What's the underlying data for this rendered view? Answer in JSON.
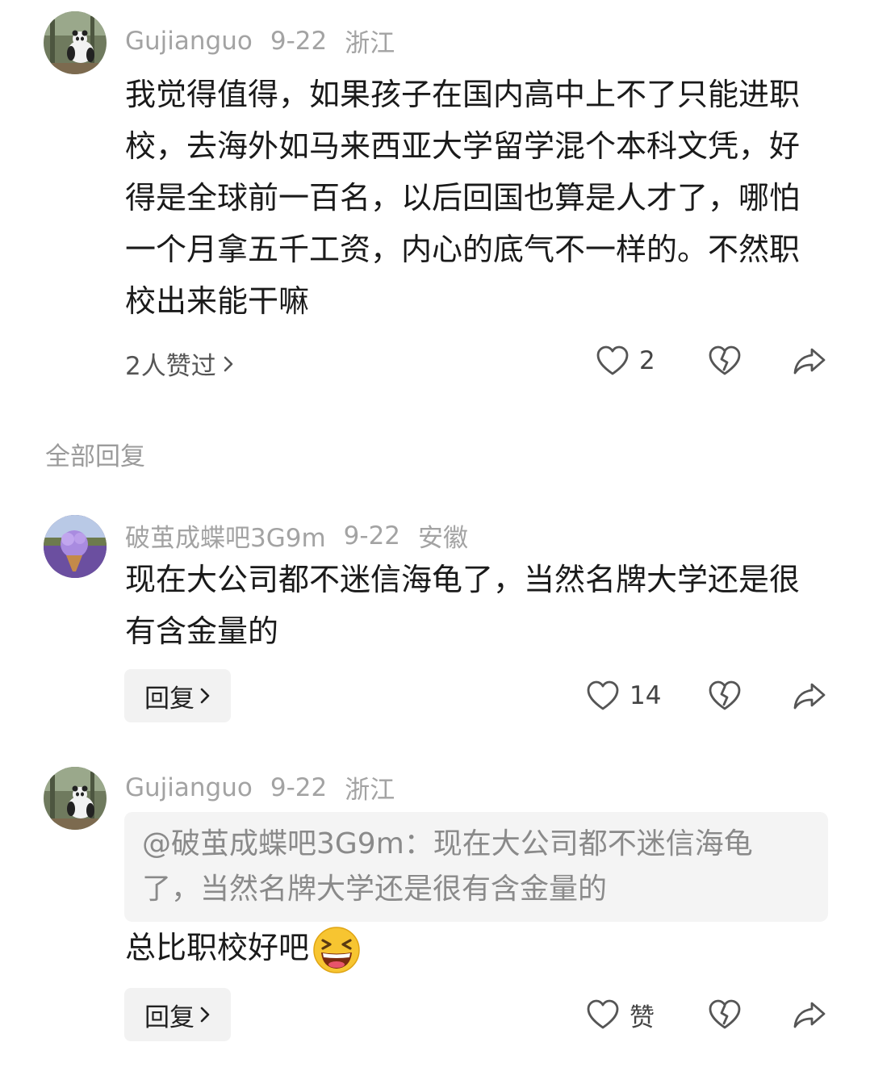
{
  "post": {
    "author": "Gujianguo",
    "date": "9-22",
    "location": "浙江",
    "text": "我觉得值得，如果孩子在国内高中上不了只能进职校，去海外如马来西亚大学留学混个本科文凭，好得是全球前一百名，以后回国也算是人才了，哪怕一个月拿五千工资，内心的底气不一样的。不然职校出来能干嘛",
    "liked_by": "2人赞过",
    "like_count": "2"
  },
  "section_label": "全部回复",
  "replies": [
    {
      "author": "破茧成蝶吧3G9m",
      "date": "9-22",
      "location": "安徽",
      "text": "现在大公司都不迷信海龟了，当然名牌大学还是很有含金量的",
      "reply_label": "回复",
      "like_count": "14"
    },
    {
      "author": "Gujianguo",
      "date": "9-22",
      "location": "浙江",
      "quote": "@破茧成蝶吧3G9m：现在大公司都不迷信海龟了，当然名牌大学还是很有含金量的",
      "text": "总比职校好吧",
      "emoji": "grinning-squinting-face-emoji",
      "reply_label": "回复",
      "like_label": "赞"
    }
  ],
  "icons": {
    "like": "heart-icon",
    "dislike": "broken-heart-icon",
    "share": "share-arrow-icon",
    "chevron": "chevron-right-icon"
  },
  "colors": {
    "meta_text": "#a3a3a3",
    "quote_bg": "#f4f4f4",
    "button_bg": "#f2f2f2"
  }
}
